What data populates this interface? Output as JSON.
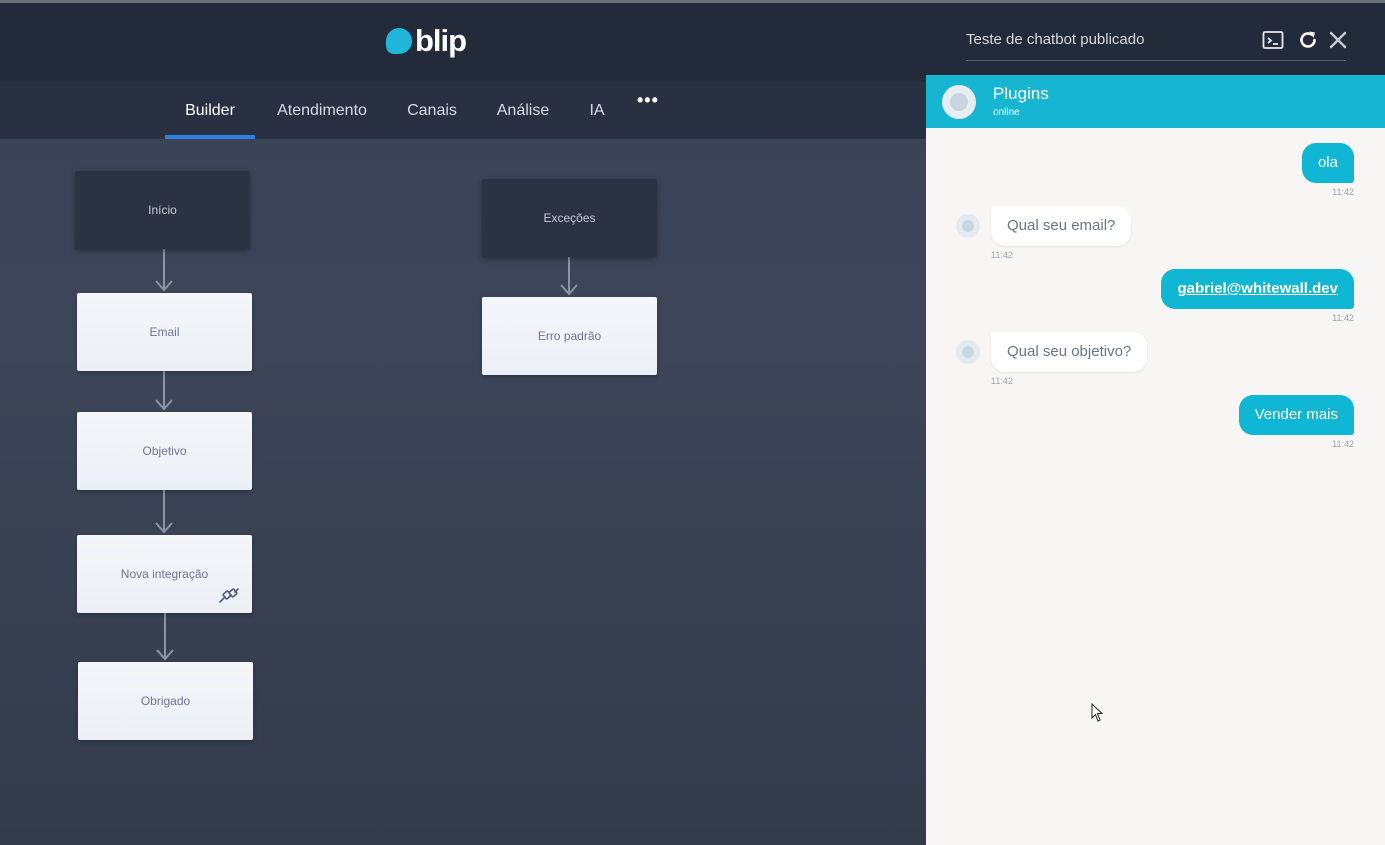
{
  "app": {
    "logo_text": "blip"
  },
  "nav": {
    "items": [
      {
        "label": "Builder",
        "active": true
      },
      {
        "label": "Atendimento",
        "active": false
      },
      {
        "label": "Canais",
        "active": false
      },
      {
        "label": "Análise",
        "active": false
      },
      {
        "label": "IA",
        "active": false
      }
    ],
    "more_label": "•••"
  },
  "flow": {
    "nodes": [
      {
        "label": "Início"
      },
      {
        "label": "Email"
      },
      {
        "label": "Objetivo"
      },
      {
        "label": "Nova integração"
      },
      {
        "label": "Obrigado"
      },
      {
        "label": "Exceções"
      },
      {
        "label": "Erro padrão"
      }
    ]
  },
  "chat": {
    "title": "Teste de chatbot publicado",
    "icons": [
      "terminal-icon",
      "refresh-icon",
      "close-icon"
    ],
    "contact": {
      "name": "Plugins",
      "status": "online"
    },
    "messages": [
      {
        "direction": "out",
        "text": "ola",
        "time": "11:42"
      },
      {
        "direction": "in",
        "text": "Qual seu email?",
        "time": "11:42"
      },
      {
        "direction": "out",
        "text": "gabriel@whitewall.dev",
        "time": "11:42",
        "link": true
      },
      {
        "direction": "in",
        "text": "Qual seu objetivo?",
        "time": "11:42"
      },
      {
        "direction": "out",
        "text": "Vender mais",
        "time": "11:42"
      }
    ]
  },
  "colors": {
    "accent": "#10b7d4",
    "nav_active": "#2f7fe0",
    "header_bg": "#232a39"
  }
}
